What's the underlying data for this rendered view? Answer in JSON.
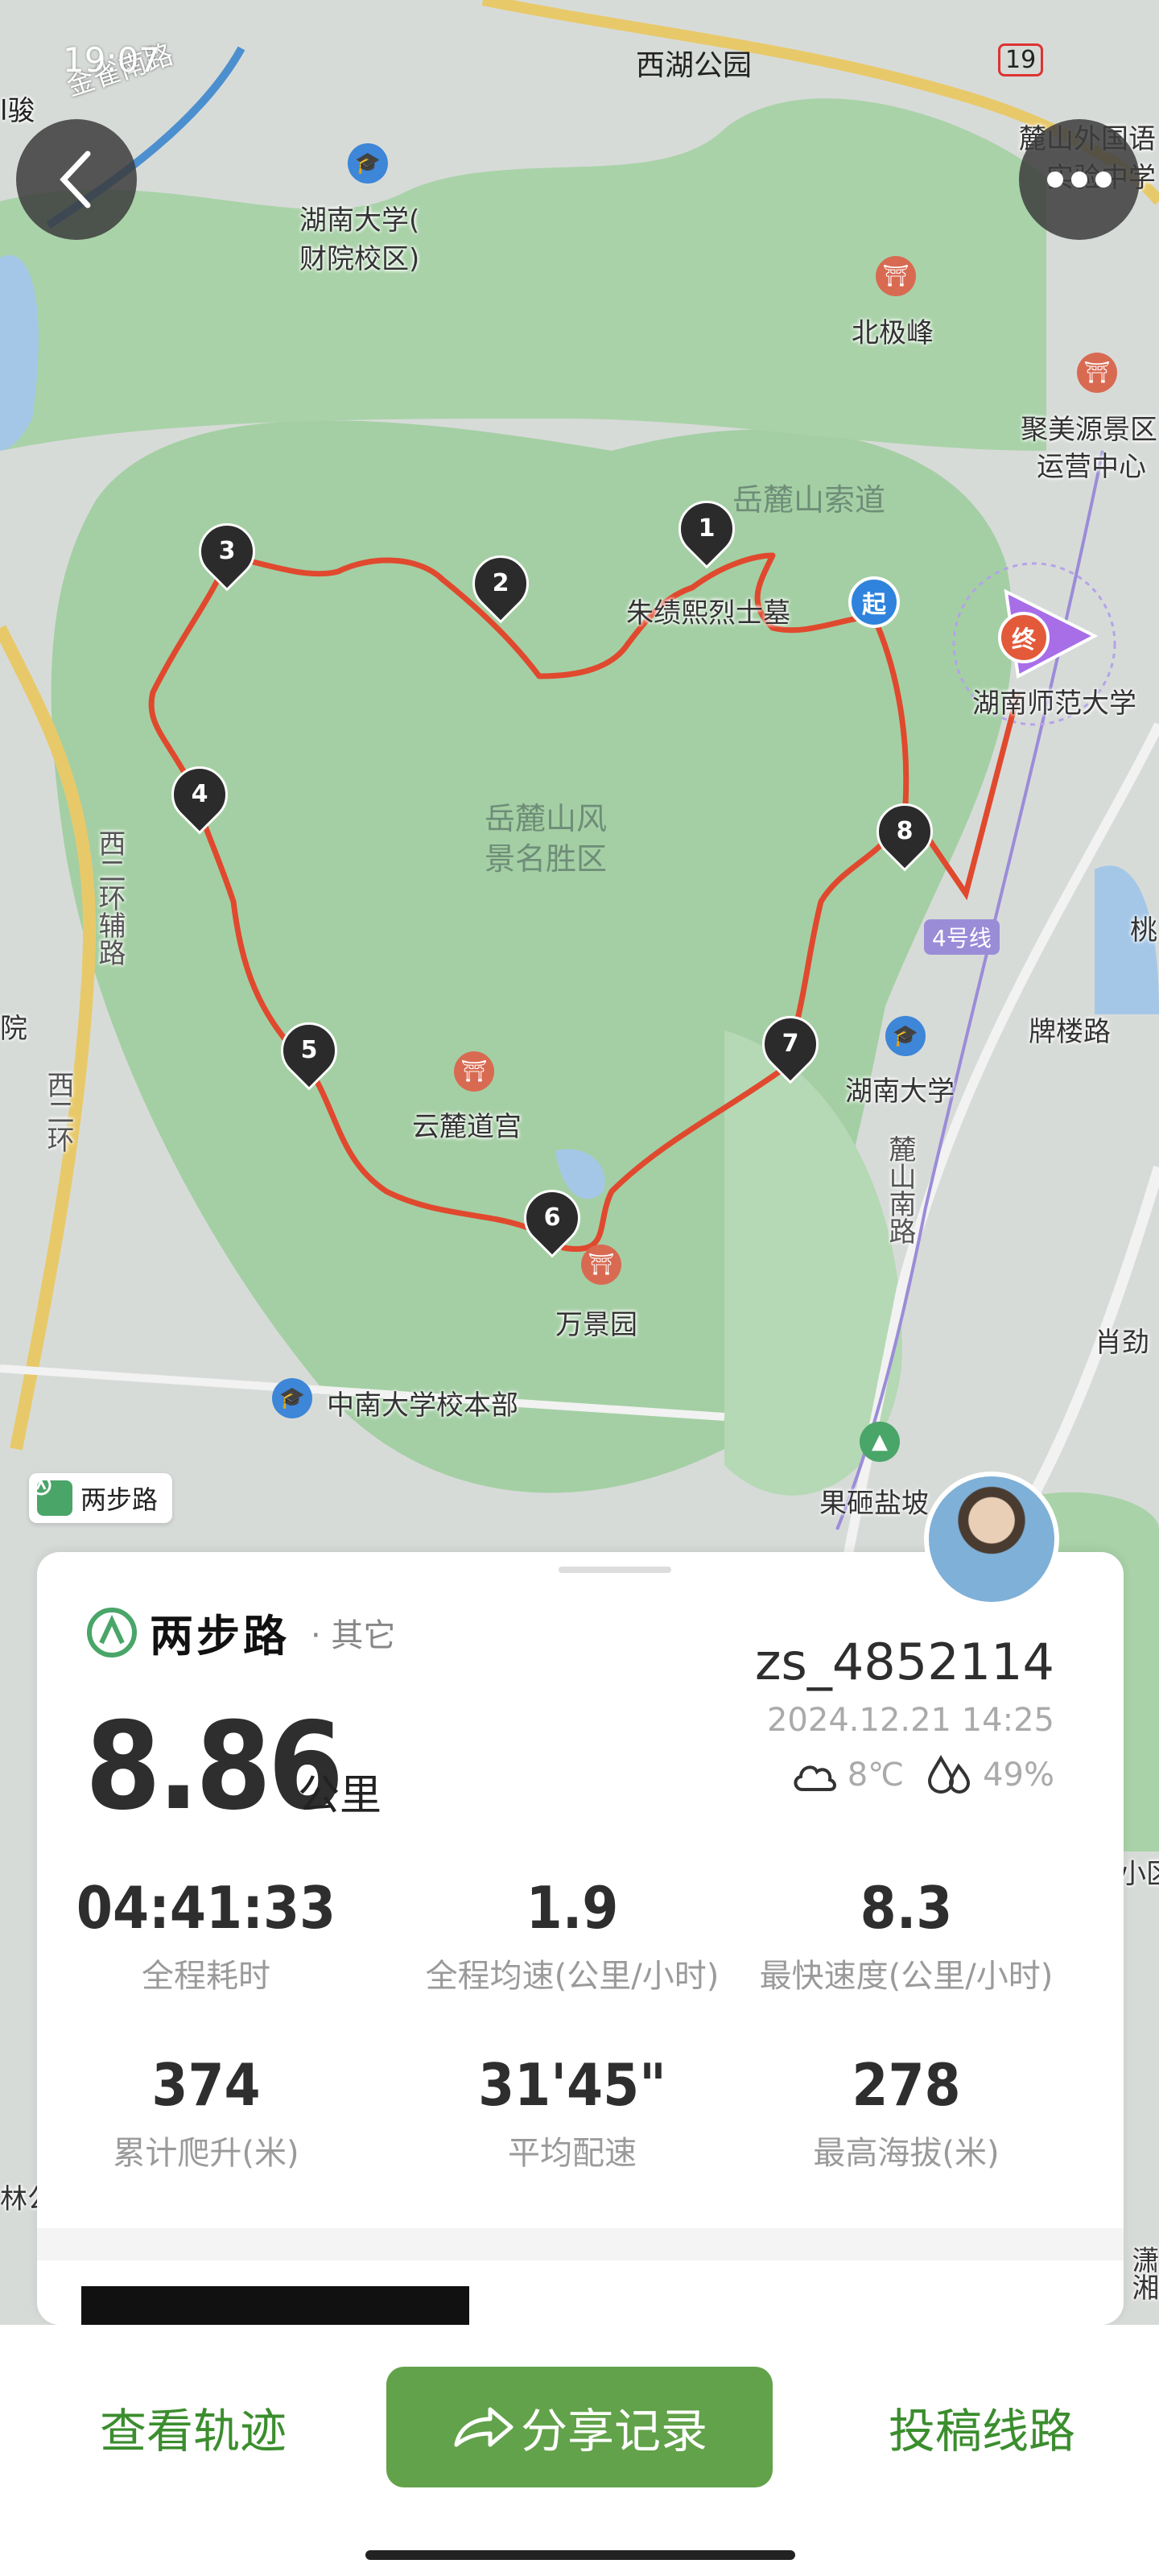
{
  "status": {
    "time": "19:07",
    "location": "西湖公园",
    "battery": "19"
  },
  "map": {
    "labels": {
      "jinque": "金雀南路",
      "hunan_univ_finance": "湖南大学(",
      "hunan_univ_finance2": "财院校区)",
      "beiji": "北极峰",
      "jumeiyuan": "聚美源景区",
      "jumeiyuan2": "运营中心",
      "lushan_foreign": "麓山外国语",
      "lushan_foreign2": "实验中学",
      "cableway": "岳麓山索道",
      "zhuji": "朱绩熙烈士墓",
      "normal_univ": "湖南师范大学",
      "scenic": "岳麓山风",
      "scenic2": "景名胜区",
      "xierhuan_aux": "西二环辅路",
      "xierhuan": "西二环",
      "line4": "4号线",
      "pailou": "牌楼路",
      "hunan_univ": "湖南大学",
      "yunlu": "云麓道宫",
      "wanjing": "万景园",
      "lushan_south": "麓山南路",
      "central_south": "中南大学校本部",
      "guobian": "果砸盐坡",
      "yuan": "院",
      "xiaojin": "肖劲",
      "xiaoqu": "小区",
      "xiao": "潇湘",
      "lin": "林公",
      "hu": "湖南",
      "jun": "l骏",
      "tao": "桃"
    },
    "markers": [
      "1",
      "2",
      "3",
      "4",
      "5",
      "6",
      "7",
      "8"
    ],
    "start": "起",
    "end": "终",
    "watermark": "两步路",
    "route_color": "#e0492e"
  },
  "card": {
    "brand": "两步路",
    "category": "· 其它",
    "distance": "8.86",
    "distance_unit": "公里",
    "username": "zs_4852114",
    "datetime": "2024.12.21 14:25",
    "temperature": "8℃",
    "humidity": "49%",
    "stats": [
      {
        "value": "04:41:33",
        "label": "全程耗时"
      },
      {
        "value": "1.9",
        "label": "全程均速(公里/小时)"
      },
      {
        "value": "8.3",
        "label": "最快速度(公里/小时)"
      },
      {
        "value": "374",
        "label": "累计爬升(米)"
      },
      {
        "value": "31'45\"",
        "label": "平均配速"
      },
      {
        "value": "278",
        "label": "最高海拔(米)"
      }
    ]
  },
  "bottom": {
    "view_track": "查看轨迹",
    "share": "分享记录",
    "submit_route": "投稿线路"
  },
  "colors": {
    "accent": "#62a24a",
    "accent_text": "#3b8d2e",
    "route": "#e0492e"
  }
}
